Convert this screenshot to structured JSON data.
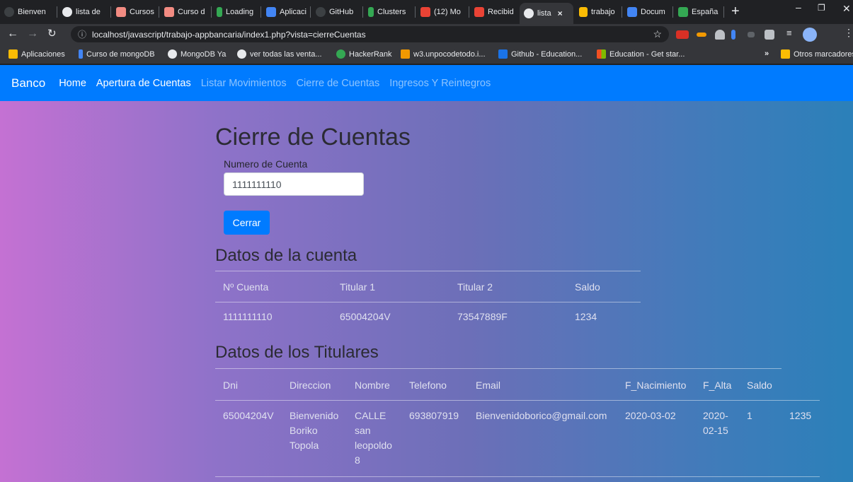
{
  "browser": {
    "tabs": [
      {
        "title": "Bienven",
        "color": "#3c4043"
      },
      {
        "title": "lista de",
        "color": "#e8eaed"
      },
      {
        "title": "Cursos",
        "color": "#f28b82"
      },
      {
        "title": "Curso d",
        "color": "#f28b82"
      },
      {
        "title": "Loading",
        "color": "#34a853"
      },
      {
        "title": "Aplicaci",
        "color": "#4285f4"
      },
      {
        "title": "GitHub",
        "color": "#3c4043"
      },
      {
        "title": "Clusters",
        "color": "#34a853"
      },
      {
        "title": "(12) Mo",
        "color": "#ea4335"
      },
      {
        "title": "Recibid",
        "color": "#ea4335"
      },
      {
        "title": "lista",
        "color": "#e8eaed"
      },
      {
        "title": "trabajo",
        "color": "#fbbc04"
      },
      {
        "title": "Docum",
        "color": "#4285f4"
      },
      {
        "title": "España",
        "color": "#34a853"
      }
    ],
    "url": "localhost/javascript/trabajo-appbancaria/index1.php?vista=cierreCuentas",
    "bookmarks": [
      {
        "label": "Aplicaciones",
        "color": "#fbbc04"
      },
      {
        "label": "Curso de mongoDB",
        "color": "#4285f4"
      },
      {
        "label": "MongoDB Ya",
        "color": "#e8eaed"
      },
      {
        "label": "ver todas las venta...",
        "color": "#e8eaed"
      },
      {
        "label": "HackerRank",
        "color": "#34a853"
      },
      {
        "label": "w3.unpocodetodo.i...",
        "color": "#f29900"
      },
      {
        "label": "Github - Education...",
        "color": "#1a73e8"
      },
      {
        "label": "Education - Get star...",
        "color": "#f25022"
      }
    ],
    "bookmarks_overflow": "»",
    "other_bookmarks": "Otros marcadores"
  },
  "nav": {
    "brand": "Banco",
    "links": [
      "Home",
      "Apertura de Cuentas",
      "Listar Movimientos",
      "Cierre de Cuentas",
      "Ingresos Y Reintegros"
    ]
  },
  "form": {
    "title": "Cierre de Cuentas",
    "label": "Numero de Cuenta",
    "value": "1111111110",
    "button": "Cerrar"
  },
  "account": {
    "heading": "Datos de la cuenta",
    "headers": [
      "Nº Cuenta",
      "Titular 1",
      "Titular 2",
      "Saldo"
    ],
    "row": [
      "1111111110",
      "65004204V",
      "73547889F",
      "1234"
    ]
  },
  "holders": {
    "heading": "Datos de los Titulares",
    "headers": [
      "Dni",
      "Direccion",
      "Nombre",
      "Telefono",
      "Email",
      "F_Nacimiento",
      "F_Alta",
      "Saldo"
    ],
    "row": [
      "65004204V",
      "Bienvenido Boriko Topola",
      "CALLE san leopoldo 8",
      "693807919",
      "Bienvenidoborico@gmail.com",
      "2020-03-02",
      "2020-02-15",
      "1",
      "1235"
    ]
  }
}
